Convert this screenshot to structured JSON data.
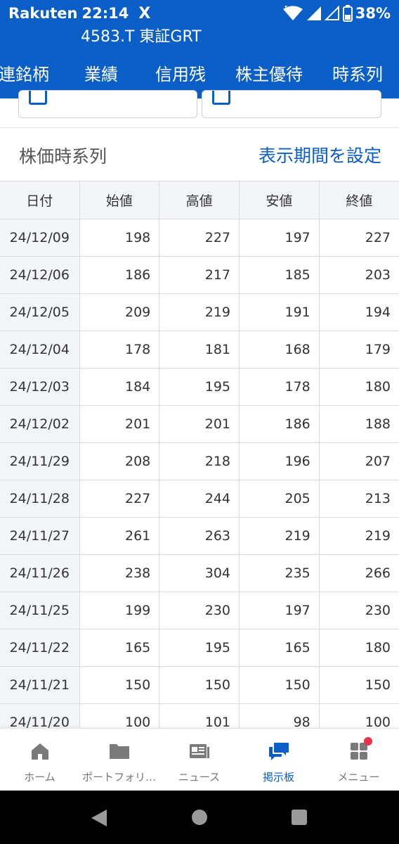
{
  "status_bar": {
    "carrier": "Rakuten",
    "time": "22:14",
    "x_logo": "X",
    "battery": "38%"
  },
  "header": {
    "ticker": "4583.T 東証GRT",
    "tabs": [
      "連銘柄",
      "業績",
      "信用残",
      "株主優待",
      "時系列"
    ]
  },
  "section": {
    "title": "株価時系列",
    "period_link": "表示期間を設定"
  },
  "table": {
    "columns": [
      "日付",
      "始値",
      "高値",
      "安値",
      "終値"
    ],
    "rows": [
      [
        "24/12/09",
        "198",
        "227",
        "197",
        "227"
      ],
      [
        "24/12/06",
        "186",
        "217",
        "185",
        "203"
      ],
      [
        "24/12/05",
        "209",
        "219",
        "191",
        "194"
      ],
      [
        "24/12/04",
        "178",
        "181",
        "168",
        "179"
      ],
      [
        "24/12/03",
        "184",
        "195",
        "178",
        "180"
      ],
      [
        "24/12/02",
        "201",
        "201",
        "186",
        "188"
      ],
      [
        "24/11/29",
        "208",
        "218",
        "196",
        "207"
      ],
      [
        "24/11/28",
        "227",
        "244",
        "205",
        "213"
      ],
      [
        "24/11/27",
        "261",
        "263",
        "219",
        "219"
      ],
      [
        "24/11/26",
        "238",
        "304",
        "235",
        "266"
      ],
      [
        "24/11/25",
        "199",
        "230",
        "197",
        "230"
      ],
      [
        "24/11/22",
        "165",
        "195",
        "165",
        "180"
      ],
      [
        "24/11/21",
        "150",
        "150",
        "150",
        "150"
      ],
      [
        "24/11/20",
        "100",
        "101",
        "98",
        "100"
      ]
    ]
  },
  "bottom_nav": [
    {
      "label": "ホーム",
      "icon": "home-icon"
    },
    {
      "label": "ポートフォリ…",
      "icon": "folder-icon"
    },
    {
      "label": "ニュース",
      "icon": "news-icon"
    },
    {
      "label": "掲示板",
      "icon": "chat-bubbles-icon",
      "active": true
    },
    {
      "label": "メニュー",
      "icon": "menu-grid-icon"
    }
  ],
  "colors": {
    "brand_blue": "#0a5ec8",
    "notification_red": "#e8344a",
    "header_cell_bg": "#f3f5f8"
  }
}
